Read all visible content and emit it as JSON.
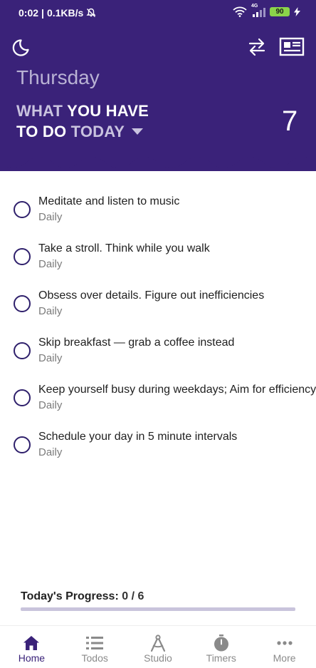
{
  "status_bar": {
    "time": "0:02",
    "network_speed": "0.1KB/s",
    "network_type": "4G",
    "battery": "90",
    "icons": [
      "bell-off-icon",
      "wifi-icon",
      "signal-icon",
      "battery-icon",
      "charging-icon"
    ]
  },
  "header": {
    "day": "Thursday",
    "heading_line1_a": "WHAT",
    "heading_line1_b": "YOU HAVE",
    "heading_line2_a": "TO DO",
    "heading_line2_b": "TODAY",
    "count": "7",
    "icons": [
      "moon-icon",
      "swap-icon",
      "newspaper-icon",
      "caret-down-icon"
    ],
    "colors": {
      "primary": "#3a2279",
      "day_text": "#b9b2d4"
    }
  },
  "todos": [
    {
      "title": "Meditate and listen to music",
      "frequency": "Daily"
    },
    {
      "title": "Take a stroll. Think while you walk",
      "frequency": "Daily"
    },
    {
      "title": "Obsess over details. Figure out inefficiencies",
      "frequency": "Daily"
    },
    {
      "title": "Skip breakfast — grab a coffee instead",
      "frequency": "Daily"
    },
    {
      "title": "Keep yourself busy during weekdays; Aim for efficiency",
      "frequency": "Daily"
    },
    {
      "title": "Schedule your day in 5 minute intervals",
      "frequency": "Daily"
    }
  ],
  "progress": {
    "label": "Today's Progress:",
    "value": "0 / 6",
    "fraction": 0
  },
  "nav": {
    "items": [
      {
        "label": "Home",
        "icon": "home-icon",
        "active": true
      },
      {
        "label": "Todos",
        "icon": "list-icon",
        "active": false
      },
      {
        "label": "Studio",
        "icon": "compass-icon",
        "active": false
      },
      {
        "label": "Timers",
        "icon": "stopwatch-icon",
        "active": false
      },
      {
        "label": "More",
        "icon": "more-icon",
        "active": false
      }
    ]
  }
}
